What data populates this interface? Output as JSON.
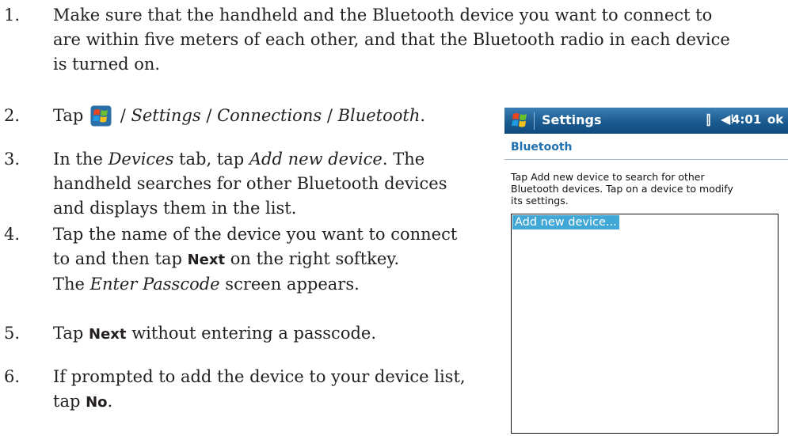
{
  "steps": [
    {
      "num": "1.",
      "lines": [
        "Make sure that the handheld and the Bluetooth device you want to connect to",
        "are within five meters of each other, and that the Bluetooth radio in each device",
        "is turned on."
      ]
    },
    {
      "num": "2.",
      "tap": "Tap",
      "path_sep": " / ",
      "path": [
        "Settings",
        "Connections",
        "Bluetooth"
      ],
      "end": "."
    },
    {
      "num": "3.",
      "pre": "In the ",
      "tab": "Devices",
      "mid": " tab, tap ",
      "link": "Add new device",
      "post": ". The",
      "lines": [
        "handheld searches for other Bluetooth devices",
        "and displays them in the list."
      ]
    },
    {
      "num": "4.",
      "line1": "Tap the name of the device you want to connect",
      "pre": "to and then tap ",
      "bold": "Next",
      "post": " on the right softkey."
    },
    {
      "num": "5.",
      "pre": "Tap ",
      "bold": "Next",
      "post": " without entering a passcode."
    },
    {
      "num": "6.",
      "line1": "If prompted to add the device to your device list,",
      "pre": "tap ",
      "bold": "No",
      "post": "."
    }
  ],
  "step4_note": {
    "pre": "The ",
    "screen": "Enter Passcode",
    "post": " screen appears."
  },
  "device_screen": {
    "title": "Settings",
    "time": "4:01",
    "ok": "ok",
    "header": "Bluetooth",
    "description_lines": [
      "Tap Add new device to search for other",
      "Bluetooth devices. Tap on a device to modify",
      "its settings."
    ],
    "list_items": [
      "Add new device..."
    ],
    "icons": [
      "windows-start-icon",
      "signal-icon",
      "volume-icon"
    ]
  }
}
